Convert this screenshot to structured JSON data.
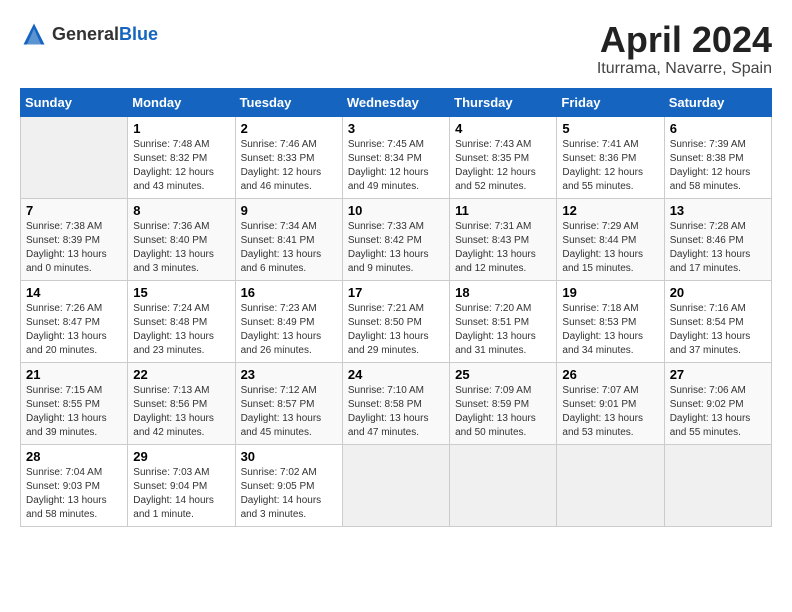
{
  "header": {
    "logo_general": "General",
    "logo_blue": "Blue",
    "month": "April 2024",
    "location": "Iturrama, Navarre, Spain"
  },
  "weekdays": [
    "Sunday",
    "Monday",
    "Tuesday",
    "Wednesday",
    "Thursday",
    "Friday",
    "Saturday"
  ],
  "weeks": [
    [
      {
        "day": "",
        "sunrise": "",
        "sunset": "",
        "daylight": ""
      },
      {
        "day": "1",
        "sunrise": "Sunrise: 7:48 AM",
        "sunset": "Sunset: 8:32 PM",
        "daylight": "Daylight: 12 hours and 43 minutes."
      },
      {
        "day": "2",
        "sunrise": "Sunrise: 7:46 AM",
        "sunset": "Sunset: 8:33 PM",
        "daylight": "Daylight: 12 hours and 46 minutes."
      },
      {
        "day": "3",
        "sunrise": "Sunrise: 7:45 AM",
        "sunset": "Sunset: 8:34 PM",
        "daylight": "Daylight: 12 hours and 49 minutes."
      },
      {
        "day": "4",
        "sunrise": "Sunrise: 7:43 AM",
        "sunset": "Sunset: 8:35 PM",
        "daylight": "Daylight: 12 hours and 52 minutes."
      },
      {
        "day": "5",
        "sunrise": "Sunrise: 7:41 AM",
        "sunset": "Sunset: 8:36 PM",
        "daylight": "Daylight: 12 hours and 55 minutes."
      },
      {
        "day": "6",
        "sunrise": "Sunrise: 7:39 AM",
        "sunset": "Sunset: 8:38 PM",
        "daylight": "Daylight: 12 hours and 58 minutes."
      }
    ],
    [
      {
        "day": "7",
        "sunrise": "Sunrise: 7:38 AM",
        "sunset": "Sunset: 8:39 PM",
        "daylight": "Daylight: 13 hours and 0 minutes."
      },
      {
        "day": "8",
        "sunrise": "Sunrise: 7:36 AM",
        "sunset": "Sunset: 8:40 PM",
        "daylight": "Daylight: 13 hours and 3 minutes."
      },
      {
        "day": "9",
        "sunrise": "Sunrise: 7:34 AM",
        "sunset": "Sunset: 8:41 PM",
        "daylight": "Daylight: 13 hours and 6 minutes."
      },
      {
        "day": "10",
        "sunrise": "Sunrise: 7:33 AM",
        "sunset": "Sunset: 8:42 PM",
        "daylight": "Daylight: 13 hours and 9 minutes."
      },
      {
        "day": "11",
        "sunrise": "Sunrise: 7:31 AM",
        "sunset": "Sunset: 8:43 PM",
        "daylight": "Daylight: 13 hours and 12 minutes."
      },
      {
        "day": "12",
        "sunrise": "Sunrise: 7:29 AM",
        "sunset": "Sunset: 8:44 PM",
        "daylight": "Daylight: 13 hours and 15 minutes."
      },
      {
        "day": "13",
        "sunrise": "Sunrise: 7:28 AM",
        "sunset": "Sunset: 8:46 PM",
        "daylight": "Daylight: 13 hours and 17 minutes."
      }
    ],
    [
      {
        "day": "14",
        "sunrise": "Sunrise: 7:26 AM",
        "sunset": "Sunset: 8:47 PM",
        "daylight": "Daylight: 13 hours and 20 minutes."
      },
      {
        "day": "15",
        "sunrise": "Sunrise: 7:24 AM",
        "sunset": "Sunset: 8:48 PM",
        "daylight": "Daylight: 13 hours and 23 minutes."
      },
      {
        "day": "16",
        "sunrise": "Sunrise: 7:23 AM",
        "sunset": "Sunset: 8:49 PM",
        "daylight": "Daylight: 13 hours and 26 minutes."
      },
      {
        "day": "17",
        "sunrise": "Sunrise: 7:21 AM",
        "sunset": "Sunset: 8:50 PM",
        "daylight": "Daylight: 13 hours and 29 minutes."
      },
      {
        "day": "18",
        "sunrise": "Sunrise: 7:20 AM",
        "sunset": "Sunset: 8:51 PM",
        "daylight": "Daylight: 13 hours and 31 minutes."
      },
      {
        "day": "19",
        "sunrise": "Sunrise: 7:18 AM",
        "sunset": "Sunset: 8:53 PM",
        "daylight": "Daylight: 13 hours and 34 minutes."
      },
      {
        "day": "20",
        "sunrise": "Sunrise: 7:16 AM",
        "sunset": "Sunset: 8:54 PM",
        "daylight": "Daylight: 13 hours and 37 minutes."
      }
    ],
    [
      {
        "day": "21",
        "sunrise": "Sunrise: 7:15 AM",
        "sunset": "Sunset: 8:55 PM",
        "daylight": "Daylight: 13 hours and 39 minutes."
      },
      {
        "day": "22",
        "sunrise": "Sunrise: 7:13 AM",
        "sunset": "Sunset: 8:56 PM",
        "daylight": "Daylight: 13 hours and 42 minutes."
      },
      {
        "day": "23",
        "sunrise": "Sunrise: 7:12 AM",
        "sunset": "Sunset: 8:57 PM",
        "daylight": "Daylight: 13 hours and 45 minutes."
      },
      {
        "day": "24",
        "sunrise": "Sunrise: 7:10 AM",
        "sunset": "Sunset: 8:58 PM",
        "daylight": "Daylight: 13 hours and 47 minutes."
      },
      {
        "day": "25",
        "sunrise": "Sunrise: 7:09 AM",
        "sunset": "Sunset: 8:59 PM",
        "daylight": "Daylight: 13 hours and 50 minutes."
      },
      {
        "day": "26",
        "sunrise": "Sunrise: 7:07 AM",
        "sunset": "Sunset: 9:01 PM",
        "daylight": "Daylight: 13 hours and 53 minutes."
      },
      {
        "day": "27",
        "sunrise": "Sunrise: 7:06 AM",
        "sunset": "Sunset: 9:02 PM",
        "daylight": "Daylight: 13 hours and 55 minutes."
      }
    ],
    [
      {
        "day": "28",
        "sunrise": "Sunrise: 7:04 AM",
        "sunset": "Sunset: 9:03 PM",
        "daylight": "Daylight: 13 hours and 58 minutes."
      },
      {
        "day": "29",
        "sunrise": "Sunrise: 7:03 AM",
        "sunset": "Sunset: 9:04 PM",
        "daylight": "Daylight: 14 hours and 1 minute."
      },
      {
        "day": "30",
        "sunrise": "Sunrise: 7:02 AM",
        "sunset": "Sunset: 9:05 PM",
        "daylight": "Daylight: 14 hours and 3 minutes."
      },
      {
        "day": "",
        "sunrise": "",
        "sunset": "",
        "daylight": ""
      },
      {
        "day": "",
        "sunrise": "",
        "sunset": "",
        "daylight": ""
      },
      {
        "day": "",
        "sunrise": "",
        "sunset": "",
        "daylight": ""
      },
      {
        "day": "",
        "sunrise": "",
        "sunset": "",
        "daylight": ""
      }
    ]
  ]
}
